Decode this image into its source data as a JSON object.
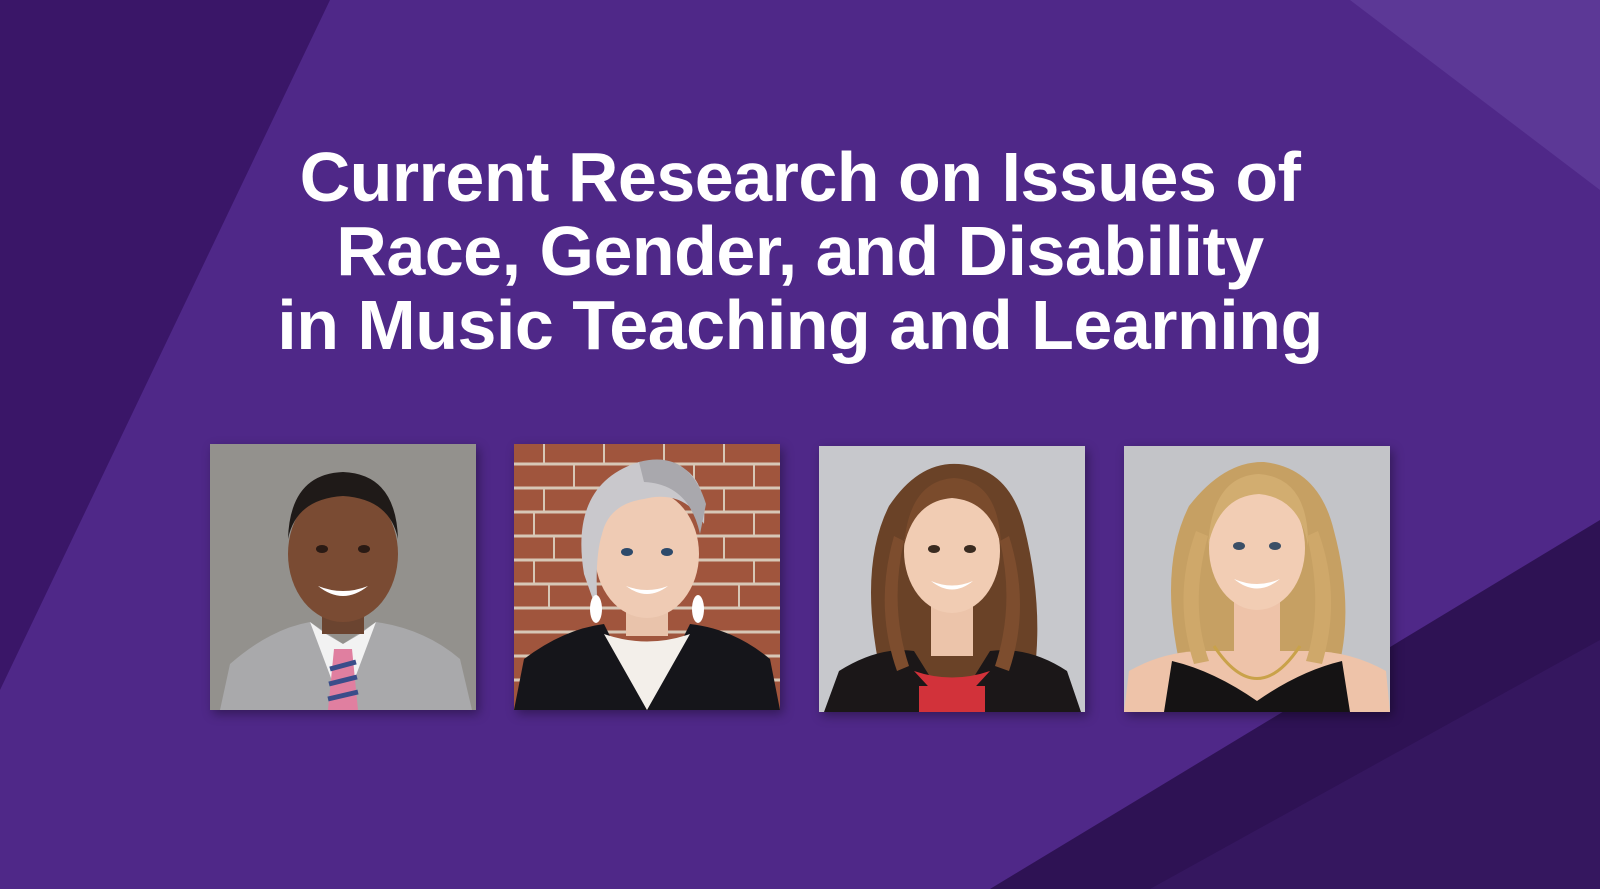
{
  "slide": {
    "title_lines": [
      "Current Research on Issues of",
      "Race, Gender, and Disability",
      "in Music Teaching and Learning"
    ]
  },
  "colors": {
    "background": "#4f2888",
    "dark_shape": "#3a1668",
    "deep_shape": "#2e1254",
    "light_shape": "#5c3896",
    "title_text": "#ffffff"
  },
  "photos": [
    {
      "icon": "person-portrait-icon",
      "background": "gray-wall"
    },
    {
      "icon": "person-portrait-icon",
      "background": "brick-wall"
    },
    {
      "icon": "person-portrait-icon",
      "background": "light-gray"
    },
    {
      "icon": "person-portrait-icon",
      "background": "light-gray"
    }
  ]
}
